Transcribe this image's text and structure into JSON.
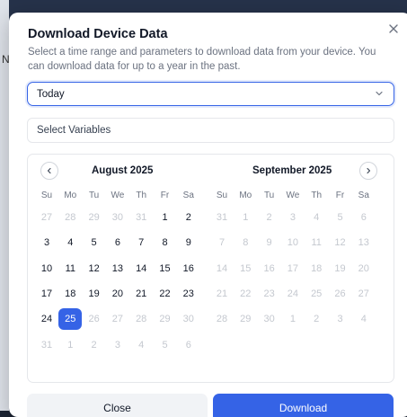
{
  "backdrop": {
    "letter": "N"
  },
  "dialog": {
    "title": "Download Device Data",
    "description": "Select a time range and parameters to download data from your device. You can download data for up to a year in the past.",
    "close_icon": "close-icon"
  },
  "time_range": {
    "selected": "Today",
    "icon": "chevron-down-icon"
  },
  "variables": {
    "placeholder": "Select Variables"
  },
  "calendar": {
    "weekdays": [
      "Su",
      "Mo",
      "Tu",
      "We",
      "Th",
      "Fr",
      "Sa"
    ],
    "selected_day": "25",
    "months": [
      {
        "title": "August 2025",
        "nav": "prev",
        "weeks": [
          [
            [
              "27",
              0
            ],
            [
              "28",
              0
            ],
            [
              "29",
              0
            ],
            [
              "30",
              0
            ],
            [
              "31",
              0
            ],
            [
              "1",
              1
            ],
            [
              "2",
              1
            ]
          ],
          [
            [
              "3",
              1
            ],
            [
              "4",
              1
            ],
            [
              "5",
              1
            ],
            [
              "6",
              1
            ],
            [
              "7",
              1
            ],
            [
              "8",
              1
            ],
            [
              "9",
              1
            ]
          ],
          [
            [
              "10",
              1
            ],
            [
              "11",
              1
            ],
            [
              "12",
              1
            ],
            [
              "13",
              1
            ],
            [
              "14",
              1
            ],
            [
              "15",
              1
            ],
            [
              "16",
              1
            ]
          ],
          [
            [
              "17",
              1
            ],
            [
              "18",
              1
            ],
            [
              "19",
              1
            ],
            [
              "20",
              1
            ],
            [
              "21",
              1
            ],
            [
              "22",
              1
            ],
            [
              "23",
              1
            ]
          ],
          [
            [
              "24",
              1
            ],
            [
              "25",
              2
            ],
            [
              "26",
              0
            ],
            [
              "27",
              0
            ],
            [
              "28",
              0
            ],
            [
              "29",
              0
            ],
            [
              "30",
              0
            ]
          ],
          [
            [
              "31",
              0
            ],
            [
              "1",
              0
            ],
            [
              "2",
              0
            ],
            [
              "3",
              0
            ],
            [
              "4",
              0
            ],
            [
              "5",
              0
            ],
            [
              "6",
              0
            ]
          ]
        ]
      },
      {
        "title": "September 2025",
        "nav": "next",
        "weeks": [
          [
            [
              "31",
              0
            ],
            [
              "1",
              0
            ],
            [
              "2",
              0
            ],
            [
              "3",
              0
            ],
            [
              "4",
              0
            ],
            [
              "5",
              0
            ],
            [
              "6",
              0
            ]
          ],
          [
            [
              "7",
              0
            ],
            [
              "8",
              0
            ],
            [
              "9",
              0
            ],
            [
              "10",
              0
            ],
            [
              "11",
              0
            ],
            [
              "12",
              0
            ],
            [
              "13",
              0
            ]
          ],
          [
            [
              "14",
              0
            ],
            [
              "15",
              0
            ],
            [
              "16",
              0
            ],
            [
              "17",
              0
            ],
            [
              "18",
              0
            ],
            [
              "19",
              0
            ],
            [
              "20",
              0
            ]
          ],
          [
            [
              "21",
              0
            ],
            [
              "22",
              0
            ],
            [
              "23",
              0
            ],
            [
              "24",
              0
            ],
            [
              "25",
              0
            ],
            [
              "26",
              0
            ],
            [
              "27",
              0
            ]
          ],
          [
            [
              "28",
              0
            ],
            [
              "29",
              0
            ],
            [
              "30",
              0
            ],
            [
              "1",
              0
            ],
            [
              "2",
              0
            ],
            [
              "3",
              0
            ],
            [
              "4",
              0
            ]
          ]
        ]
      }
    ]
  },
  "footer": {
    "close_label": "Close",
    "download_label": "Download"
  },
  "colors": {
    "accent": "#3563e6",
    "muted_text": "#c4c8cf",
    "body_text": "#111827"
  }
}
